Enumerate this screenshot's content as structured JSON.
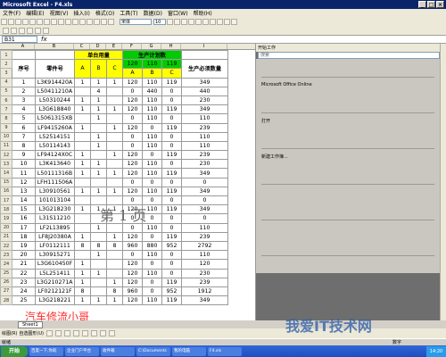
{
  "window": {
    "title": "Microsoft Excel - F4.xls",
    "buttons": [
      "_",
      "□",
      "×"
    ]
  },
  "menu": [
    "文件(F)",
    "编辑(E)",
    "视图(V)",
    "插入(I)",
    "格式(O)",
    "工具(T)",
    "数据(D)",
    "窗口(W)",
    "帮助(H)"
  ],
  "toolbar": {
    "font": "宋体",
    "size": "10"
  },
  "formula": {
    "namebox": "B31",
    "fx": "fx"
  },
  "columns": [
    "A",
    "B",
    "C",
    "D",
    "E",
    "F",
    "G",
    "H",
    "I",
    "J"
  ],
  "headers": {
    "seq": "序号",
    "part": "零件号",
    "unit": "单台用量",
    "plan": "生产计划数",
    "need": "生产必须数量",
    "abc": [
      "A",
      "B",
      "C"
    ],
    "plan_vals": [
      "120",
      "110",
      "119"
    ],
    "plan_abc": [
      "A",
      "B",
      "C"
    ]
  },
  "rows": [
    [
      "1",
      "L3K914420A",
      "1",
      "1",
      "1",
      "120",
      "110",
      "119",
      "349"
    ],
    [
      "2",
      "L50411210A",
      "",
      "4",
      "",
      "0",
      "440",
      "0",
      "440"
    ],
    [
      "3",
      "L50310244",
      "1",
      "1",
      "",
      "120",
      "110",
      "0",
      "230"
    ],
    [
      "4",
      "L3G618840",
      "1",
      "1",
      "1",
      "120",
      "110",
      "119",
      "349"
    ],
    [
      "5",
      "L5061315XB",
      "",
      "1",
      "",
      "0",
      "110",
      "0",
      "110"
    ],
    [
      "6",
      "LF9415260A",
      "1",
      "",
      "1",
      "120",
      "0",
      "119",
      "239"
    ],
    [
      "7",
      "L52514151",
      "",
      "1",
      "",
      "0",
      "110",
      "0",
      "110"
    ],
    [
      "8",
      "L50114143",
      "",
      "1",
      "",
      "0",
      "110",
      "0",
      "110"
    ],
    [
      "9",
      "LF94124X0C",
      "1",
      "",
      "1",
      "120",
      "0",
      "119",
      "239"
    ],
    [
      "10",
      "L3K413640",
      "1",
      "1",
      "",
      "120",
      "110",
      "0",
      "230"
    ],
    [
      "11",
      "L50111316B",
      "1",
      "1",
      "1",
      "120",
      "110",
      "119",
      "349"
    ],
    [
      "12",
      "LFH111506A",
      "",
      "",
      "",
      "0",
      "0",
      "0",
      "0"
    ],
    [
      "13",
      "L30910561",
      "1",
      "1",
      "1",
      "120",
      "110",
      "119",
      "349"
    ],
    [
      "14",
      "101013104",
      "",
      "",
      "",
      "0",
      "0",
      "0",
      "0"
    ],
    [
      "15",
      "L3G218230",
      "1",
      "1",
      "1",
      "120",
      "110",
      "119",
      "349"
    ],
    [
      "16",
      "L31S11210",
      "",
      "",
      "",
      "0",
      "0",
      "0",
      "0"
    ],
    [
      "17",
      "LF2L13895",
      "",
      "1",
      "",
      "0",
      "110",
      "0",
      "110"
    ],
    [
      "18",
      "LF8J20380A",
      "1",
      "",
      "1",
      "120",
      "0",
      "119",
      "239"
    ],
    [
      "19",
      "LF0112111",
      "8",
      "8",
      "8",
      "960",
      "880",
      "952",
      "2792"
    ],
    [
      "20",
      "L30915271",
      "",
      "1",
      "",
      "0",
      "110",
      "0",
      "110"
    ],
    [
      "21",
      "L3G610450F",
      "1",
      "",
      "",
      "120",
      "0",
      "0",
      "120"
    ],
    [
      "22",
      "L5L251411",
      "1",
      "1",
      "",
      "120",
      "110",
      "0",
      "230"
    ],
    [
      "23",
      "L3G210271A",
      "1",
      "",
      "1",
      "120",
      "0",
      "119",
      "239"
    ],
    [
      "24",
      "LF0212121F",
      "8",
      "",
      "8",
      "960",
      "0",
      "952",
      "1912"
    ],
    [
      "25",
      "L3G218221",
      "1",
      "1",
      "1",
      "120",
      "110",
      "119",
      "349"
    ]
  ],
  "overlays": {
    "page_mark": "第 1 页",
    "red_text": "汽车修流小哥"
  },
  "taskpane": {
    "title": "开始工作",
    "search": "搜索",
    "items": [
      "Microsoft Office Online",
      "打开",
      "新建工作簿..."
    ]
  },
  "sheettabs": [
    "Sheet1"
  ],
  "drawbar": {
    "label": "绘图(R)",
    "autoshapes": "自选图形(U)"
  },
  "status": {
    "ready": "就绪",
    "num": "数字"
  },
  "taskbar": {
    "start": "开始",
    "tasks": [
      "百度一下,你就",
      "企业门户平台",
      "收件箱",
      "C:\\Documents",
      "我的电脑",
      "F4.xls"
    ],
    "clock": "14:20"
  },
  "watermark": "我爱IT技术网",
  "colors": {
    "yellow": "#ffff00",
    "green": "#00cc00",
    "title": "#0a246a"
  }
}
